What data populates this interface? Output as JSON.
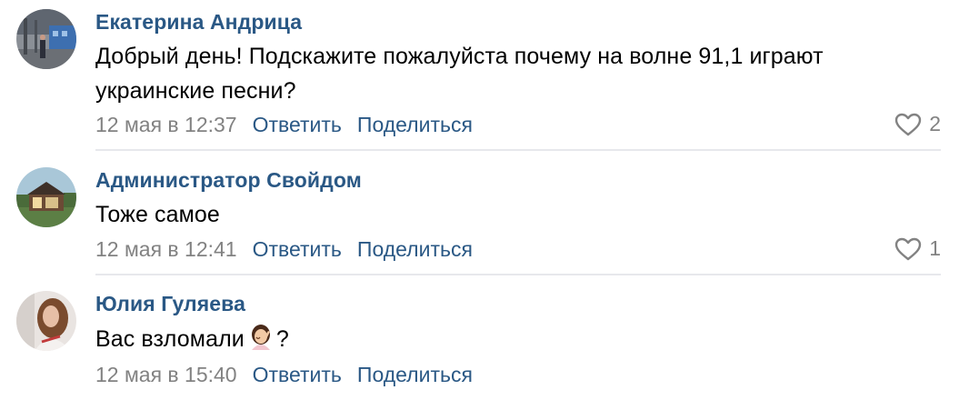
{
  "comments": [
    {
      "author": "Екатерина Андрица",
      "text": "Добрый день! Подскажите пожалуйста почему на волне 91,1 играют украинские песни?",
      "date": "12 мая в 12:37",
      "reply_label": "Ответить",
      "share_label": "Поделиться",
      "likes": "2"
    },
    {
      "author": "Администратор Свойдом",
      "text": "Тоже самое",
      "date": "12 мая в 12:41",
      "reply_label": "Ответить",
      "share_label": "Поделиться",
      "likes": "1"
    },
    {
      "author": "Юлия Гуляева",
      "text_before_emoji": "Вас взломали",
      "text_after_emoji": "?",
      "emoji_icon": "person-facepalming-icon",
      "date": "12 мая в 15:40",
      "reply_label": "Ответить",
      "share_label": "Поделиться"
    }
  ],
  "colors": {
    "link": "#2a5885",
    "meta": "#828282",
    "divider": "#e7e8ec"
  }
}
